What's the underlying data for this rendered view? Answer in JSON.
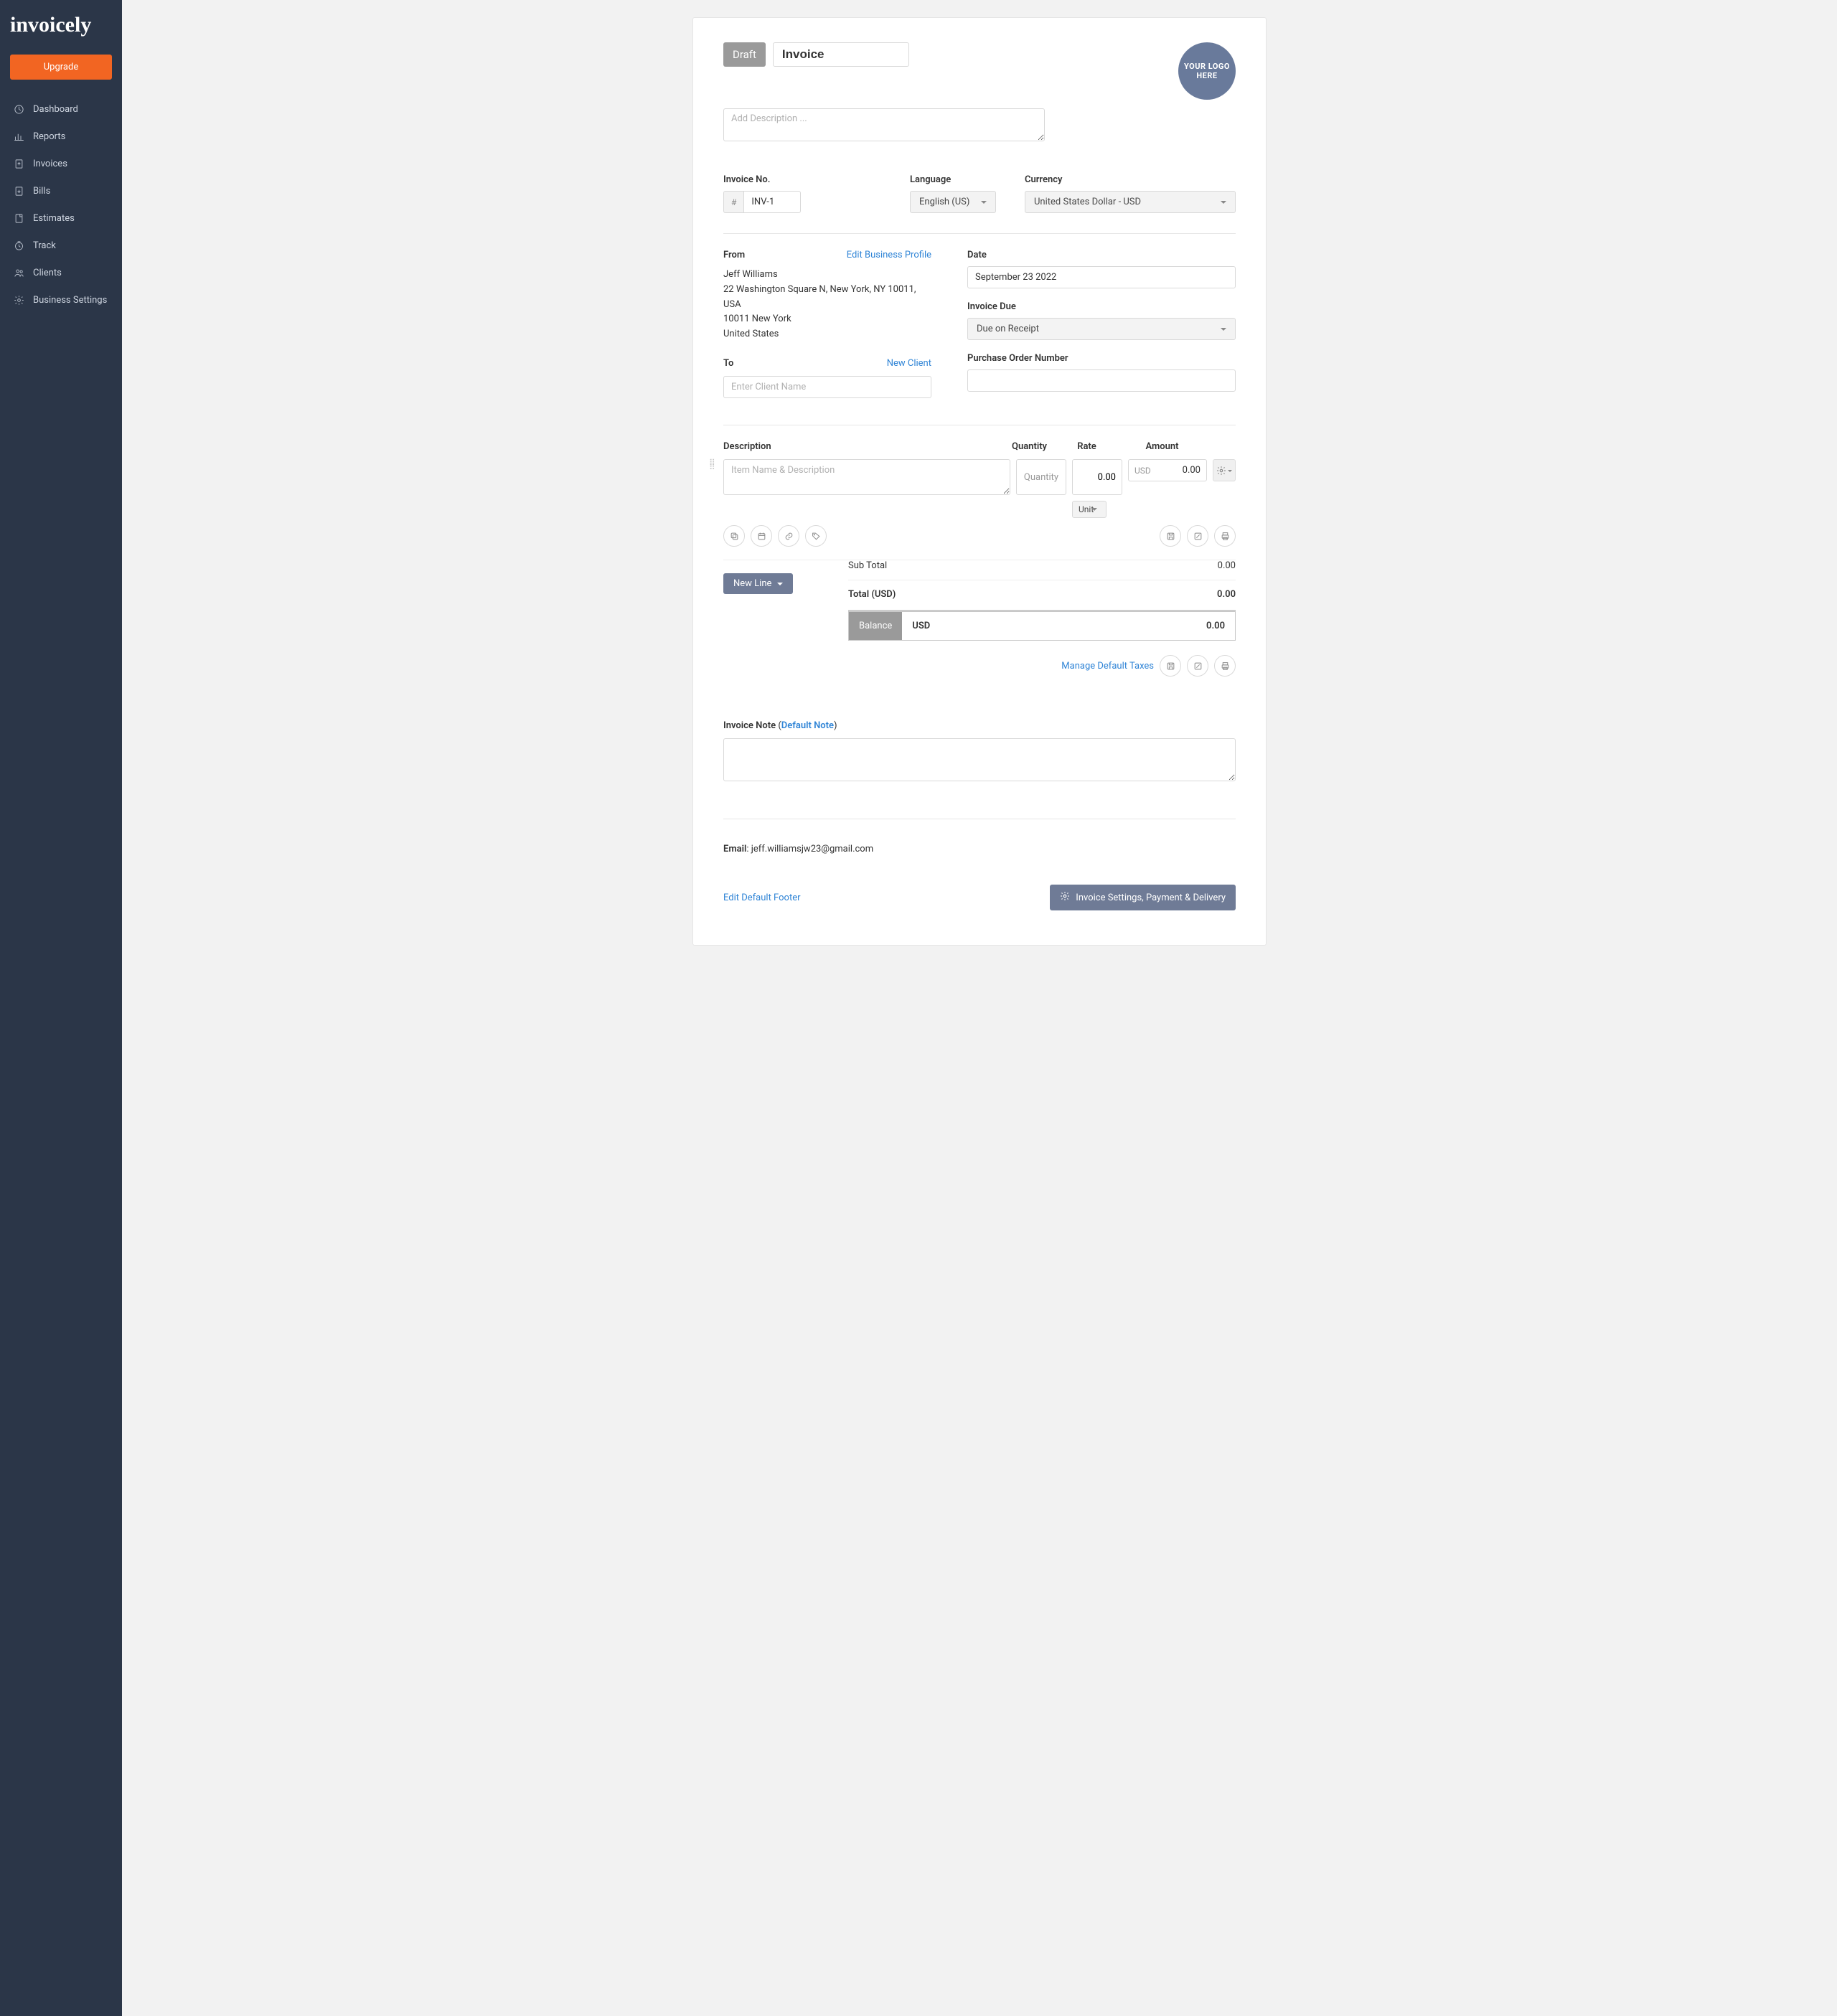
{
  "brand": "invoicely",
  "sidebar": {
    "upgrade": "Upgrade",
    "items": [
      {
        "label": "Dashboard"
      },
      {
        "label": "Reports"
      },
      {
        "label": "Invoices"
      },
      {
        "label": "Bills"
      },
      {
        "label": "Estimates"
      },
      {
        "label": "Track"
      },
      {
        "label": "Clients"
      },
      {
        "label": "Business Settings"
      }
    ]
  },
  "header": {
    "status": "Draft",
    "title": "Invoice",
    "desc_placeholder": "Add Description ...",
    "logo_text": "YOUR LOGO HERE"
  },
  "meta": {
    "invoice_no_label": "Invoice No.",
    "invoice_no_prefix": "#",
    "invoice_no": "INV-1",
    "language_label": "Language",
    "language": "English (US)",
    "currency_label": "Currency",
    "currency": "United States Dollar - USD"
  },
  "from": {
    "label": "From",
    "edit_link": "Edit Business Profile",
    "name": "Jeff Williams",
    "line1": "22 Washington Square N, New York, NY 10011, USA",
    "line2": "10011 New York",
    "country": "United States"
  },
  "to": {
    "label": "To",
    "new_client": "New Client",
    "placeholder": "Enter Client Name"
  },
  "dates": {
    "date_label": "Date",
    "date": "September 23 2022",
    "due_label": "Invoice Due",
    "due": "Due on Receipt",
    "po_label": "Purchase Order Number"
  },
  "table": {
    "desc": "Description",
    "qty": "Quantity",
    "rate": "Rate",
    "amount": "Amount",
    "item_placeholder": "Item Name & Description",
    "qty_placeholder": "Quantity",
    "rate_value": "0.00",
    "amount_currency": "USD",
    "amount_value": "0.00",
    "unit": "Unit",
    "new_line": "New Line"
  },
  "totals": {
    "sub_label": "Sub Total",
    "sub_value": "0.00",
    "total_label": "Total (USD)",
    "total_value": "0.00",
    "balance_label": "Balance",
    "balance_currency": "USD",
    "balance_value": "0.00",
    "manage_taxes": "Manage Default Taxes"
  },
  "note": {
    "label": "Invoice Note",
    "default_link": "Default Note"
  },
  "footer": {
    "email_label": "Email",
    "email": "jeff.williamsjw23@gmail.com",
    "edit_footer": "Edit Default Footer",
    "settings_btn": "Invoice Settings, Payment & Delivery"
  }
}
